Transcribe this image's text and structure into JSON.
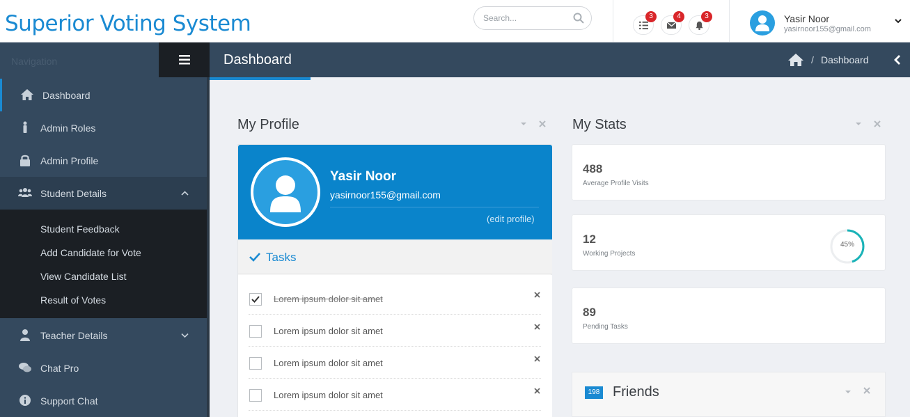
{
  "app": {
    "title": "Superior Voting System"
  },
  "header": {
    "search_placeholder": "Search...",
    "badges": {
      "tasks": "3",
      "messages": "4",
      "notifications": "3"
    },
    "user": {
      "name": "Yasir Noor",
      "email": "yasirnoor155@gmail.com"
    }
  },
  "sidebar": {
    "title": "Navigation",
    "items": [
      {
        "label": "Dashboard",
        "icon": "home-icon"
      },
      {
        "label": "Admin Roles",
        "icon": "person-icon"
      },
      {
        "label": "Admin Profile",
        "icon": "lock-icon"
      },
      {
        "label": "Student Details",
        "icon": "users-icon"
      },
      {
        "label": "Teacher Details",
        "icon": "person-icon"
      },
      {
        "label": "Chat Pro",
        "icon": "chat-icon"
      },
      {
        "label": "Support Chat",
        "icon": "info-icon"
      }
    ],
    "subitems": [
      "Student Feedback",
      "Add Candidate for Vote",
      "View Candidate List",
      "Result of Votes"
    ]
  },
  "page": {
    "title": "Dashboard",
    "breadcrumb": {
      "separator": "/",
      "current": "Dashboard"
    }
  },
  "profile": {
    "panel_title": "My Profile",
    "name": "Yasir Noor",
    "email": "yasirnoor155@gmail.com",
    "edit_label": "(edit profile)",
    "tasks_title": "Tasks",
    "tasks": [
      {
        "text": "Lorem ipsum dolor sit amet",
        "done": true
      },
      {
        "text": "Lorem ipsum dolor sit amet",
        "done": false
      },
      {
        "text": "Lorem ipsum dolor sit amet",
        "done": false
      },
      {
        "text": "Lorem ipsum dolor sit amet",
        "done": false
      }
    ]
  },
  "stats": {
    "panel_title": "My Stats",
    "items": [
      {
        "value": "488",
        "label": "Average Profile Visits"
      },
      {
        "value": "12",
        "label": "Working Projects",
        "progress_label": "45%",
        "progress": 0.45
      },
      {
        "value": "89",
        "label": "Pending Tasks"
      }
    ]
  },
  "friends": {
    "count": "198",
    "title": "Friends"
  },
  "colors": {
    "brand": "#1a8ad2",
    "sidebar": "#34495e",
    "profile_header": "#0a84cb",
    "badge": "#d9262a",
    "ring": "#1ab3b8"
  }
}
